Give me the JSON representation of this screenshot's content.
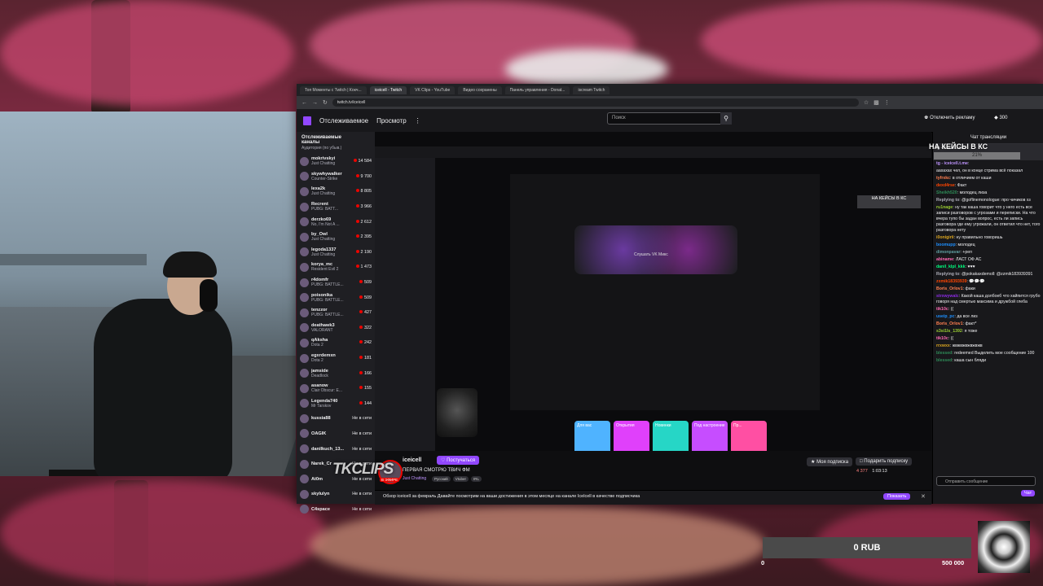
{
  "browser": {
    "tabs": [
      {
        "label": "Топ Моменты с Twitch | Кокч...",
        "active": false
      },
      {
        "label": "iceicell - Twitch",
        "active": true
      },
      {
        "label": "VK Clips - YouTube",
        "active": false
      },
      {
        "label": "Видео сохранены",
        "active": false
      },
      {
        "label": "Панель управления - Donat...",
        "active": false
      },
      {
        "label": "iscream Twitch",
        "active": false
      }
    ],
    "url": "twitch.tv/iceicell"
  },
  "twitch": {
    "nav_following": "Отслеживаемое",
    "nav_browse": "Просмотр",
    "search_placeholder": "Поиск",
    "disable_ads": "Отключить рекламу",
    "bits": "300"
  },
  "sidebar": {
    "header": "Отслеживаемые каналы",
    "sub": "Аудитория (по убыв.)",
    "channels": [
      {
        "name": "mokrivskyi",
        "game": "Just Chatting",
        "viewers": "14 584"
      },
      {
        "name": "skywhywalker",
        "game": "Counter-Strike",
        "viewers": "9 700"
      },
      {
        "name": "lexa2k",
        "game": "Just Chatting",
        "viewers": "8 805"
      },
      {
        "name": "Recrent",
        "game": "PUBG: BATT...",
        "viewers": "3 966"
      },
      {
        "name": "derzko69",
        "game": "No, I'm Not A ...",
        "viewers": "2 612"
      },
      {
        "name": "by_Owl",
        "game": "Just Chatting",
        "viewers": "2 395"
      },
      {
        "name": "legoda1337",
        "game": "Just Chatting",
        "viewers": "2 190"
      },
      {
        "name": "korya_mc",
        "game": "Resident Evil 2",
        "viewers": "1 473"
      },
      {
        "name": "r4domfr",
        "game": "PUBG: BATTLE...",
        "viewers": "509"
      },
      {
        "name": "poisonika",
        "game": "PUBG: BATTLE...",
        "viewers": "509"
      },
      {
        "name": "tenzzor",
        "game": "PUBG: BATTLE...",
        "viewers": "427"
      },
      {
        "name": "deathawk3",
        "game": "VALORANT",
        "viewers": "322"
      },
      {
        "name": "qAksha",
        "game": "Dota 2",
        "viewers": "242"
      },
      {
        "name": "egxrdemxn",
        "game": "Dota 2",
        "viewers": "181"
      },
      {
        "name": "jamside",
        "game": "Deadlock",
        "viewers": "166"
      },
      {
        "name": "asanow",
        "game": "Clair Obscur: E...",
        "viewers": "155"
      },
      {
        "name": "Legenda740",
        "game": "Mr Tarskov",
        "viewers": "144"
      },
      {
        "name": "kussia88",
        "game": "",
        "viewers": "Не в сети"
      },
      {
        "name": "OAGIK",
        "game": "",
        "viewers": "Не в сети"
      },
      {
        "name": "danilkuch_13...",
        "game": "",
        "viewers": "Не в сети"
      },
      {
        "name": "Narek_Cr",
        "game": "",
        "viewers": "Не в сети"
      },
      {
        "name": "At0m",
        "game": "",
        "viewers": "Не в сети"
      },
      {
        "name": "skylulyn",
        "game": "",
        "viewers": "Не в сети"
      },
      {
        "name": "C4space",
        "game": "",
        "viewers": "Не в сети"
      }
    ]
  },
  "player": {
    "inner_nak": "НА КЕЙСЫ В КС",
    "vk_hero": "Слушать VK Микс",
    "cards": [
      {
        "label": "Для вас",
        "color": "#4fb3ff"
      },
      {
        "label": "Открытия",
        "color": "#e040fb"
      },
      {
        "label": "Новинки",
        "color": "#26d6c6"
      },
      {
        "label": "Под настроение",
        "color": "#c64dff"
      },
      {
        "label": "Пр...",
        "color": "#ff4fa3"
      }
    ]
  },
  "stream": {
    "streamer": "iceicell",
    "follow_label": "Постучаться",
    "title": "ПЕРВАЯ СМОТРЮ ТВИЧ ФМ",
    "category": "Just Chatting",
    "tags": [
      "Русский",
      "Vtuber",
      "IRL"
    ],
    "live_badge": "В ЭФИРЕ",
    "my_sub": "Моя подписка",
    "gift_sub": "Подарить подписку",
    "viewers": "4 377",
    "uptime": "1:03:13",
    "subbar_text": "Обзор iceicell за февраль Давайте посмотрим на ваши достижения в этом месяце на канале Icelcell в качестве подписчика",
    "subbar_button": "Показать"
  },
  "chat": {
    "header": "Чат трансляции",
    "hype": "tg - iceicell.t.me",
    "messages": [
      {
        "user": "tg - iceicell.t.me",
        "color": "#bf94ff",
        "text": ""
      },
      {
        "user": "",
        "color": "#efeff1",
        "text": "аахахах чел, он в конце стрима всё показал"
      },
      {
        "user": "tyfrxkc",
        "color": "#ff7f50",
        "text": "в отличием от каши"
      },
      {
        "user": "dexd4rse",
        "color": "#ff4500",
        "text": "Факт"
      },
      {
        "user": "Sheikh520",
        "color": "#2e8b57",
        "text": "молодец лиза"
      },
      {
        "user": "Replying to",
        "color": "#adadb8",
        "text": "@goflinemonologue: про чичиков хз"
      },
      {
        "user": "ru1nage",
        "color": "#9acd32",
        "text": "ну так каша говорит что у него есть все записи разговоров с угрозами и переписки. На что вчера тупо бы задан вопрос, есть ли запись разговора где ему угрожали, он ответил что нет, того разговора нету"
      },
      {
        "user": "i0onigirii",
        "color": "#daa520",
        "text": "ну правильно говоришь"
      },
      {
        "user": "boomupp",
        "color": "#1e90ff",
        "text": "молодец"
      },
      {
        "user": "dimonpavar",
        "color": "#5f9ea0",
        "text": "+реп"
      },
      {
        "user": "abiname",
        "color": "#ff69b4",
        "text": "ЛАСТ ОФ АС"
      },
      {
        "user": "danil_klpl_kkk",
        "color": "#00ff7f",
        "text": "♥♥♥"
      },
      {
        "user": "Replying to",
        "color": "#adadb8",
        "text": "@pokakaxdemoll: @zzmik183939391"
      },
      {
        "user": "zxmik18393939",
        "color": "#ff4500",
        "text": "💬💬💬"
      },
      {
        "user": "Boris_Orlov1",
        "color": "#ff7f50",
        "text": "факи"
      },
      {
        "user": "strxwywalc",
        "color": "#8a2be2",
        "text": "Какой каша долбоеб что хайпится грубо говоря над смертью максима и дружбой глеба"
      },
      {
        "user": "tik10c",
        "color": "#ff69b4",
        "text": "(("
      },
      {
        "user": "useip_pc",
        "color": "#1e90ff",
        "text": "да все лиз"
      },
      {
        "user": "Boris_Orlov1",
        "color": "#ff7f50",
        "text": "факт*"
      },
      {
        "user": "s3si1ls_1392",
        "color": "#9acd32",
        "text": "я тоже"
      },
      {
        "user": "tik10c",
        "color": "#ff69b4",
        "text": "(("
      },
      {
        "user": "rrxwxx",
        "color": "#daa520",
        "text": "жвжвжвжвжвжв"
      },
      {
        "user": "blessed",
        "color": "#2e8b57",
        "text": "redeemed Выделить мое сообщение 100"
      },
      {
        "user": "blessed",
        "color": "#2e8b57",
        "text": "каша сын бляди"
      }
    ],
    "input_placeholder": "Отправить сообщение",
    "send_label": "Чат"
  },
  "overlay": {
    "nak_title": "НА КЕЙСЫ В КС",
    "nak_percent": "21%",
    "watermark": "TKCLIPS",
    "donation_current": "0 RUB",
    "donation_min": "0",
    "donation_max": "500 000"
  },
  "colors": {
    "twitch_purple": "#9147ff",
    "live_red": "#eb0400",
    "bg_dark": "#0e0e10"
  }
}
